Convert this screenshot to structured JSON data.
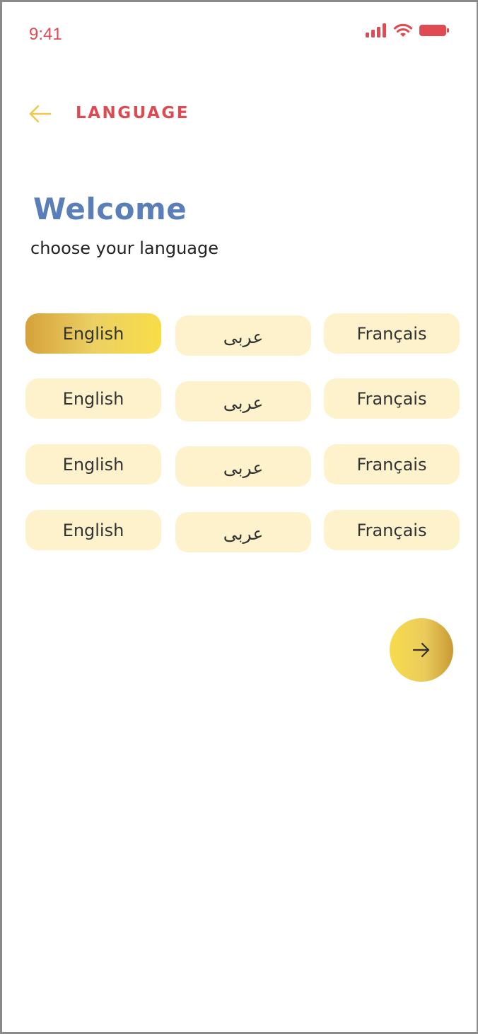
{
  "status_bar": {
    "time": "9:41",
    "icons": [
      "signal-icon",
      "wifi-icon",
      "battery-icon"
    ],
    "color": "#e04a52"
  },
  "header": {
    "back_icon": "arrow-left-icon",
    "title": "LANGUAGE"
  },
  "welcome": {
    "title": "Welcome",
    "subtitle": "choose your language"
  },
  "languages": {
    "rows": [
      [
        "English",
        "عربى",
        "Français"
      ],
      [
        "English",
        "عربى",
        "Français"
      ],
      [
        "English",
        "عربى",
        "Français"
      ],
      [
        "English",
        "عربى",
        "Français"
      ]
    ],
    "selected": "English"
  },
  "next_button": {
    "icon": "arrow-right-icon"
  },
  "colors": {
    "accent_red": "#dc4b52",
    "title_blue": "#5a7fb8",
    "chip_bg": "#fdf2cc",
    "gold_start": "#d4a23a",
    "gold_end": "#f8dd48"
  }
}
